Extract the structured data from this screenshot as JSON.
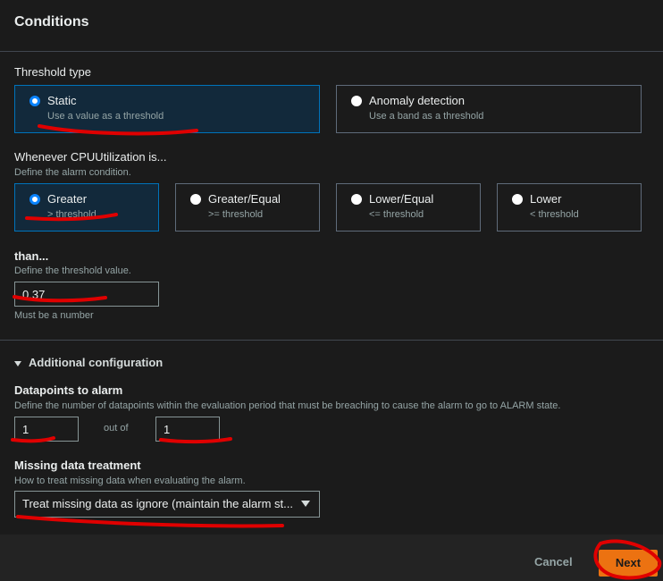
{
  "conditions": {
    "title": "Conditions"
  },
  "threshold_type": {
    "label": "Threshold type",
    "options": [
      {
        "label": "Static",
        "desc": "Use a value as a threshold",
        "selected": true
      },
      {
        "label": "Anomaly detection",
        "desc": "Use a band as a threshold",
        "selected": false
      }
    ]
  },
  "whenever": {
    "label": "Whenever CPUUtilization is...",
    "desc": "Define the alarm condition.",
    "options": [
      {
        "label": "Greater",
        "desc": "> threshold",
        "selected": true
      },
      {
        "label": "Greater/Equal",
        "desc": ">= threshold",
        "selected": false
      },
      {
        "label": "Lower/Equal",
        "desc": "<= threshold",
        "selected": false
      },
      {
        "label": "Lower",
        "desc": "< threshold",
        "selected": false
      }
    ]
  },
  "than": {
    "label": "than...",
    "desc": "Define the threshold value.",
    "value": "0.37",
    "hint": "Must be a number"
  },
  "additional": {
    "toggle_label": "Additional configuration",
    "datapoints": {
      "label": "Datapoints to alarm",
      "desc": "Define the number of datapoints within the evaluation period that must be breaching to cause the alarm to go to ALARM state.",
      "value": "1",
      "out_of": "out of",
      "total": "1"
    },
    "missing": {
      "label": "Missing data treatment",
      "desc": "How to treat missing data when evaluating the alarm.",
      "value": "Treat missing data as ignore (maintain the alarm st..."
    }
  },
  "footer": {
    "cancel_label": "Cancel",
    "next_label": "Next"
  },
  "colors": {
    "accent": "#ec7211",
    "selected_border": "#0073bb",
    "annotation": "#e00000"
  }
}
